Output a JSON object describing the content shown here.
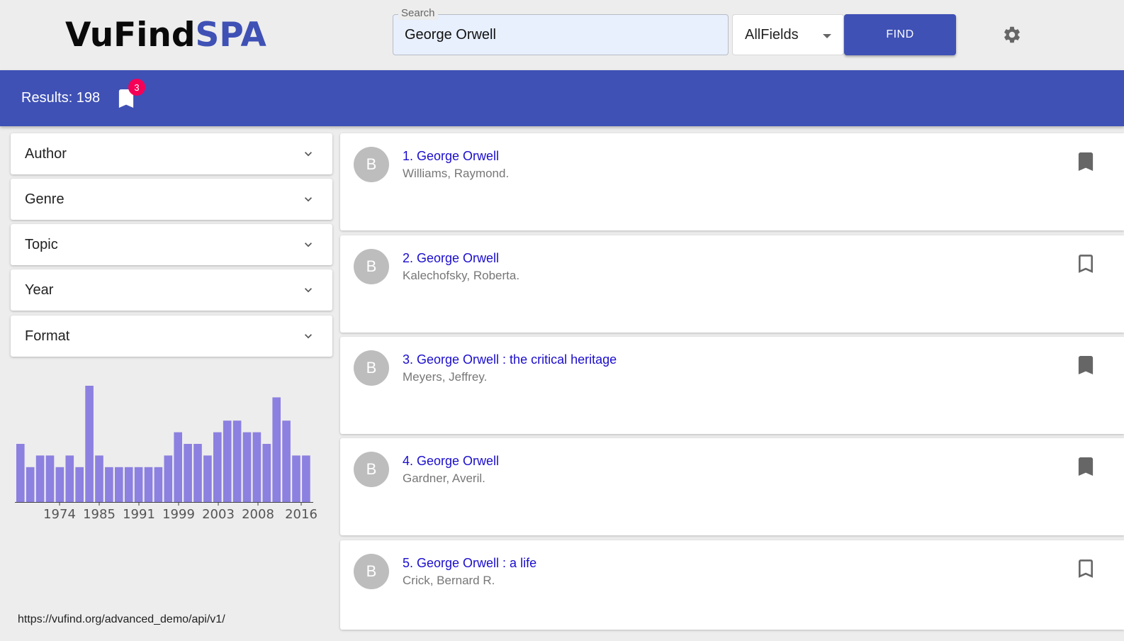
{
  "app": {
    "logo_part1": "VuFind",
    "logo_part2": "SPA"
  },
  "search": {
    "label": "Search",
    "value": "George Orwell",
    "field_selected": "AllFields",
    "find_label": "FIND"
  },
  "toolbar": {
    "results_text": "Results: 198",
    "saved_count": "3"
  },
  "facets": [
    {
      "label": "Author"
    },
    {
      "label": "Genre"
    },
    {
      "label": "Topic"
    },
    {
      "label": "Year"
    },
    {
      "label": "Format"
    }
  ],
  "chart_data": {
    "type": "bar",
    "title": "",
    "xlabel": "",
    "ylabel": "",
    "tick_labels": [
      "1974",
      "1985",
      "1991",
      "1999",
      "2003",
      "2008",
      "2016"
    ],
    "values": [
      5,
      3,
      4,
      4,
      3,
      4,
      3,
      10,
      4,
      3,
      3,
      3,
      3,
      3,
      3,
      4,
      6,
      5,
      5,
      4,
      6,
      7,
      7,
      6,
      6,
      5,
      9,
      7,
      4,
      4
    ],
    "ylim": [
      0,
      10
    ],
    "color": "#8c80e0"
  },
  "footer": {
    "api_url": "https://vufind.org/advanced_demo/api/v1/"
  },
  "results": [
    {
      "avatar": "B",
      "title": "1. George Orwell",
      "author": "Williams, Raymond.",
      "saved": true
    },
    {
      "avatar": "B",
      "title": "2. George Orwell",
      "author": "Kalechofsky, Roberta.",
      "saved": false
    },
    {
      "avatar": "B",
      "title": "3. George Orwell : the critical heritage",
      "author": "Meyers, Jeffrey.",
      "saved": true
    },
    {
      "avatar": "B",
      "title": "4. George Orwell",
      "author": "Gardner, Averil.",
      "saved": true
    },
    {
      "avatar": "B",
      "title": "5. George Orwell : a life",
      "author": "Crick, Bernard R.",
      "saved": false
    }
  ],
  "colors": {
    "primary": "#3f51b5",
    "badge": "#f50057",
    "link": "#1a0dcc"
  }
}
